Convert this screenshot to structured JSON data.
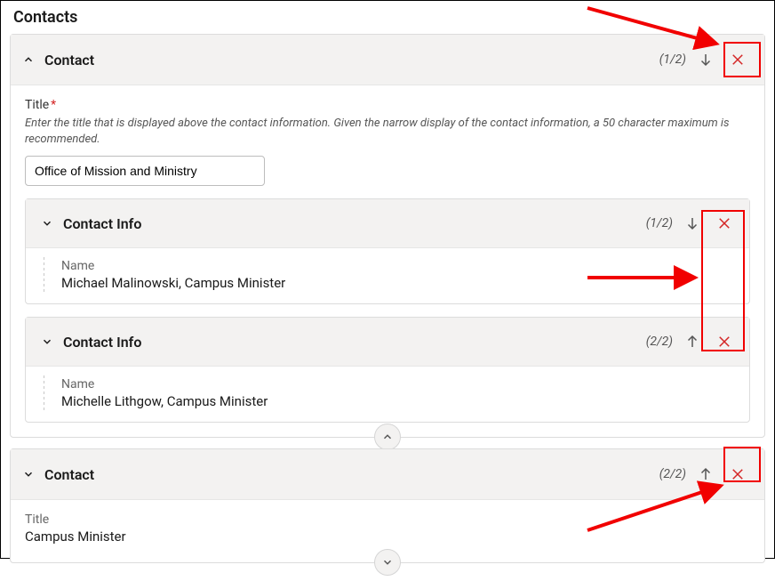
{
  "page": {
    "heading": "Contacts"
  },
  "contact1": {
    "headerLabel": "Contact",
    "counter": "(1/2)",
    "title": {
      "label": "Title",
      "help": "Enter the title that is displayed above the contact information. Given the narrow display of the contact information, a 50 character maximum is recommended.",
      "value": "Office of Mission and Ministry"
    },
    "info1": {
      "headerLabel": "Contact Info",
      "counter": "(1/2)",
      "nameLabel": "Name",
      "nameValue": "Michael Malinowski, Campus Minister"
    },
    "info2": {
      "headerLabel": "Contact Info",
      "counter": "(2/2)",
      "nameLabel": "Name",
      "nameValue": "Michelle Lithgow, Campus Minister"
    }
  },
  "contact2": {
    "headerLabel": "Contact",
    "counter": "(2/2)",
    "titleLabel": "Title",
    "titleValue": "Campus Minister"
  }
}
